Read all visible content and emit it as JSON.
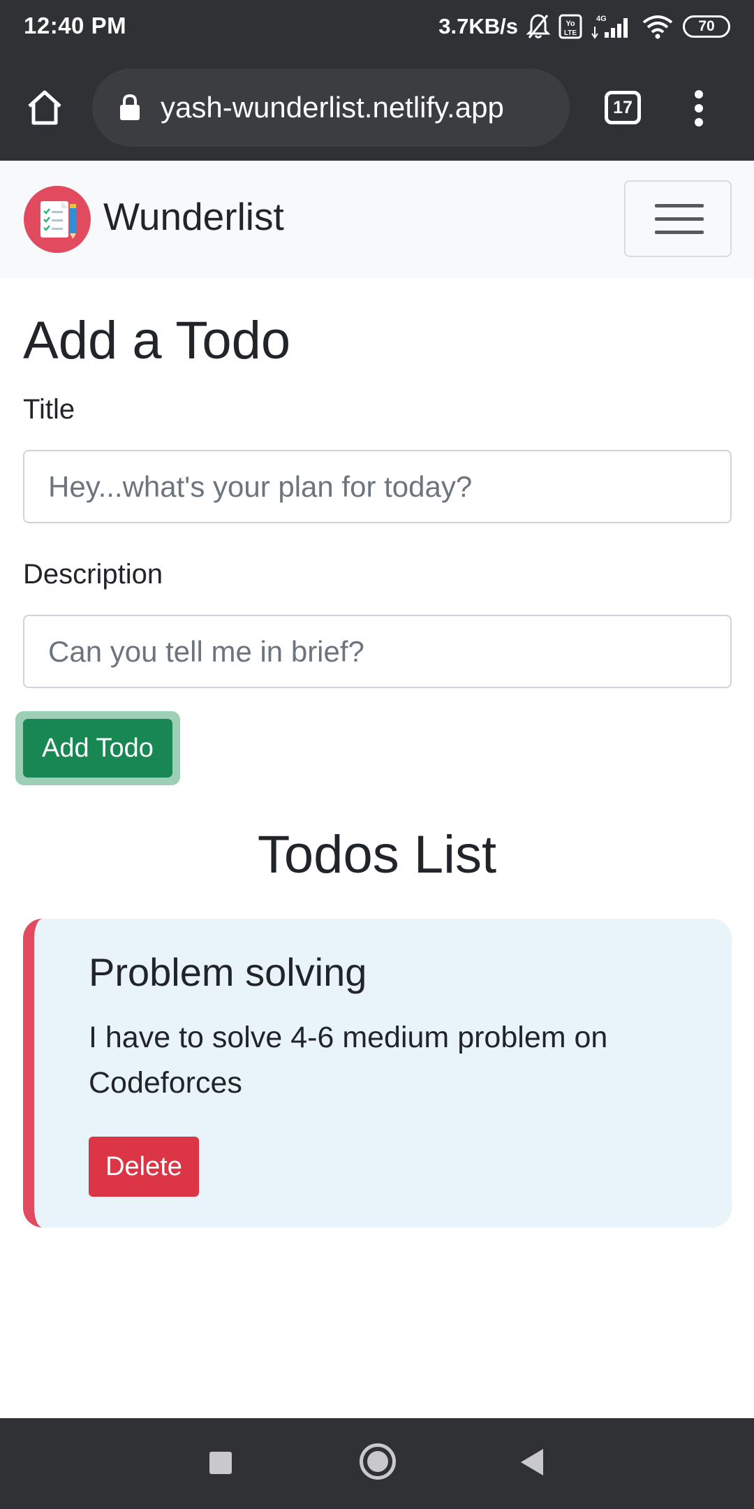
{
  "status_bar": {
    "time": "12:40 PM",
    "net_speed": "3.7KB/s",
    "battery": "70",
    "icons": [
      "mute-bell-icon",
      "volte-icon",
      "4g-signal-icon",
      "wifi-icon",
      "battery-icon"
    ]
  },
  "browser": {
    "url": "yash-wunderlist.netlify.app",
    "tab_count": "17",
    "icons": [
      "home-icon",
      "lock-icon",
      "tabs-icon",
      "more-vert-icon"
    ]
  },
  "navbar": {
    "brand": "Wunderlist",
    "logo_icon": "checklist-logo-icon",
    "toggler_icon": "hamburger-icon"
  },
  "form": {
    "heading": "Add a Todo",
    "title_label": "Title",
    "title_placeholder": "Hey...what's your plan for today?",
    "title_value": "",
    "description_label": "Description",
    "description_placeholder": "Can you tell me in brief?",
    "description_value": "",
    "submit_label": "Add Todo"
  },
  "todos": {
    "heading": "Todos List",
    "items": [
      {
        "title": "Problem solving",
        "description": "I have to solve 4-6 medium problem on Codeforces",
        "delete_label": "Delete"
      }
    ]
  },
  "colors": {
    "primary_success": "#198754",
    "danger": "#dc3545",
    "accent_red": "#e24b5f",
    "card_bg": "#e8f4f9",
    "chrome_dark": "#303134"
  },
  "android_nav": {
    "icons": [
      "recents-icon",
      "home-circle-icon",
      "back-triangle-icon"
    ]
  }
}
